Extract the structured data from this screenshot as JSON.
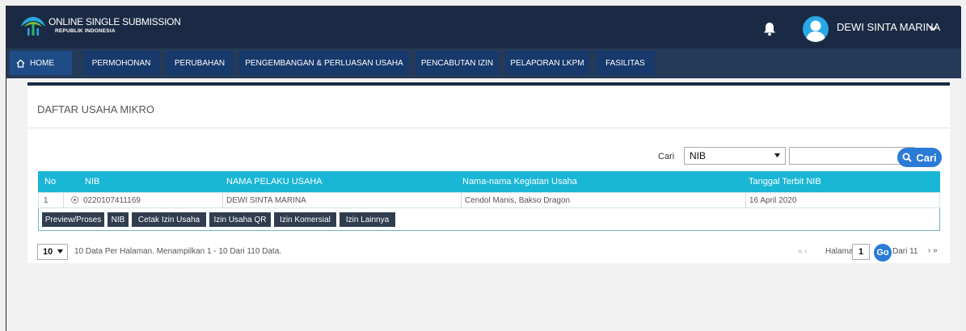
{
  "header": {
    "brand_title": "ONLINE SINGLE SUBMISSION",
    "brand_subtitle": "REPUBLIK INDONESIA",
    "user_name": "DEWI SINTA MARINA",
    "icons": {
      "logo": "oss-logo-icon",
      "bell": "bell-icon",
      "avatar": "user-avatar-icon",
      "chevron": "chevron-down-icon"
    },
    "colors": {
      "topbar": "#1b2a44",
      "navbar": "#253a57",
      "nav_item": "#17396b",
      "accent": "#1ab6d5",
      "button": "#2a7bd6"
    }
  },
  "nav": {
    "home": "HOME",
    "items": [
      "PERMOHONAN",
      "PERUBAHAN",
      "PENGEMBANGAN & PERLUASAN USAHA",
      "PENCABUTAN IZIN",
      "PELAPORAN LKPM",
      "FASILITAS"
    ]
  },
  "panel": {
    "title": "DAFTAR USAHA MIKRO",
    "search": {
      "label": "Cari",
      "selected": "NIB",
      "input_value": "",
      "button_label": "Cari"
    }
  },
  "table": {
    "headers": [
      "No",
      "NIB",
      "NAMA PELAKU USAHA",
      "Nama-nama Kegiatan Usaha",
      "Tanggal Terbit NIB"
    ],
    "rows": [
      {
        "no": "1",
        "nib": "0220107411169",
        "nama": "DEWI SINTA MARINA",
        "kegiatan": "Cendol Manis, Bakso Dragon",
        "tanggal": "16 April 2020"
      }
    ],
    "actions": [
      "Preview/Proses",
      "NIB",
      "Cetak Izin Usaha",
      "Izin Usaha QR",
      "Izin Komersial",
      "Izin Lainnya"
    ]
  },
  "pagination": {
    "page_size": "10",
    "info": "10 Data Per Halaman. Menampilkan 1 - 10 Dari 110 Data.",
    "prev": "« ‹",
    "label": "Halaman",
    "page": "1",
    "go": "Go",
    "total": "Dari 11",
    "next": "› »"
  }
}
